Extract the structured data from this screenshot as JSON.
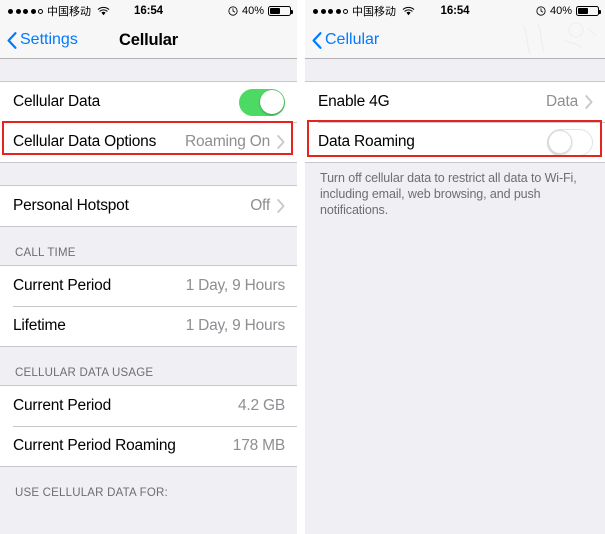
{
  "left_screen": {
    "status_bar": {
      "signal_dots_filled": 4,
      "signal_dots_total": 5,
      "carrier": "中国移动",
      "wifi": "wifi-icon",
      "time": "16:54",
      "alarm": "alarm-icon",
      "battery_percent": "40%",
      "battery_level": 40
    },
    "nav": {
      "back_label": "Settings",
      "title": "Cellular"
    },
    "group1": [
      {
        "label": "Cellular Data",
        "control": "switch",
        "switch_on": true
      },
      {
        "label": "Cellular Data Options",
        "value": "Roaming On",
        "control": "chevron",
        "highlighted": true
      }
    ],
    "group2": [
      {
        "label": "Personal Hotspot",
        "value": "Off",
        "control": "chevron"
      }
    ],
    "section_call_time": {
      "header": "CALL TIME",
      "rows": [
        {
          "label": "Current Period",
          "value": "1 Day, 9 Hours"
        },
        {
          "label": "Lifetime",
          "value": "1 Day, 9 Hours"
        }
      ]
    },
    "section_data_usage": {
      "header": "CELLULAR DATA USAGE",
      "rows": [
        {
          "label": "Current Period",
          "value": "4.2 GB"
        },
        {
          "label": "Current Period Roaming",
          "value": "178 MB"
        }
      ]
    },
    "section_use_data": {
      "header": "USE CELLULAR DATA FOR:"
    }
  },
  "right_screen": {
    "status_bar": {
      "signal_dots_filled": 4,
      "signal_dots_total": 5,
      "carrier": "中国移动",
      "wifi": "wifi-icon",
      "time": "16:54",
      "alarm": "alarm-icon",
      "battery_percent": "40%",
      "battery_level": 40
    },
    "nav": {
      "back_label": "Cellular",
      "title": ""
    },
    "group1": [
      {
        "label": "Enable 4G",
        "value": "Data",
        "control": "chevron"
      },
      {
        "label": "Data Roaming",
        "control": "switch",
        "switch_on": false,
        "highlighted": true
      }
    ],
    "footer_note": "Turn off cellular data to restrict all data to Wi-Fi, including email, web browsing, and push notifications."
  },
  "colors": {
    "accent_blue": "#007aff",
    "switch_on_green": "#4cd964",
    "highlight_red": "#e8231f",
    "value_gray": "#8e8e93",
    "group_bg": "#efeff4"
  }
}
